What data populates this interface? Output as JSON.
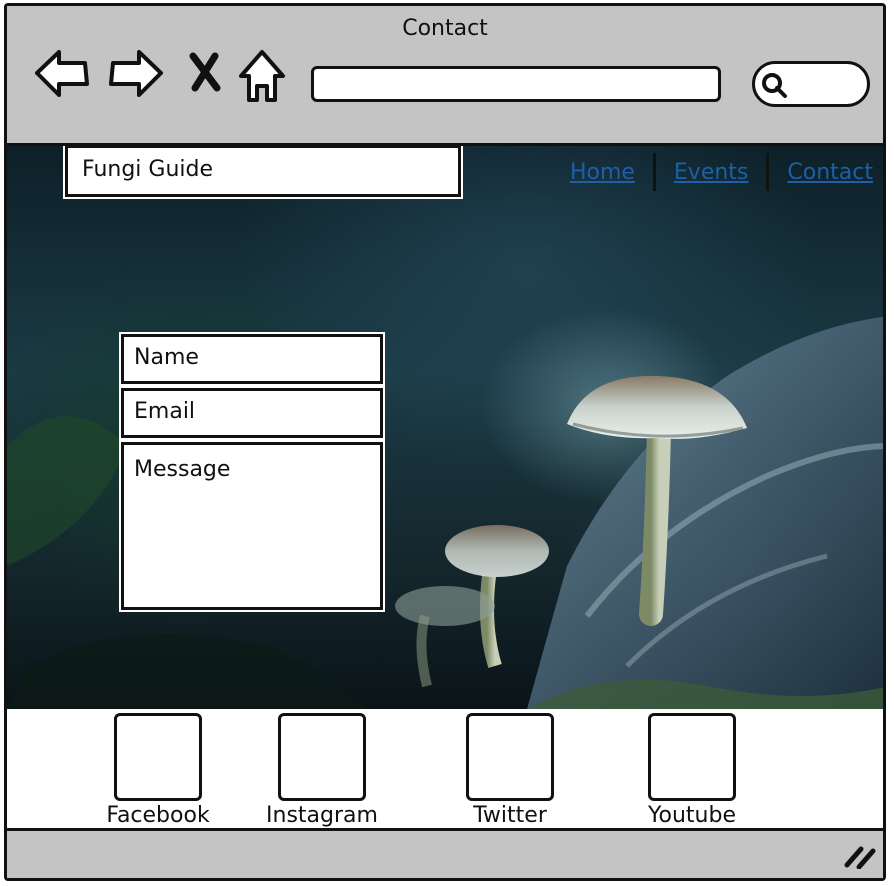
{
  "window": {
    "title": "Contact"
  },
  "toolbar": {
    "back_icon": "arrow-left-icon",
    "forward_icon": "arrow-right-icon",
    "stop_icon": "close-icon",
    "home_icon": "home-icon",
    "search_icon": "search-icon",
    "address_value": "",
    "search_value": ""
  },
  "site": {
    "brand": "Fungi Guide",
    "nav": [
      {
        "label": "Home"
      },
      {
        "label": "Events"
      },
      {
        "label": "Contact"
      }
    ]
  },
  "form": {
    "name_placeholder": "Name",
    "email_placeholder": "Email",
    "message_placeholder": "Message"
  },
  "social": [
    {
      "label": "Facebook"
    },
    {
      "label": "Instagram"
    },
    {
      "label": "Twitter"
    },
    {
      "label": "Youtube"
    }
  ],
  "statusbar": {
    "resize_icon": "resize-handle-icon"
  },
  "colors": {
    "chrome": "#c4c4c4",
    "link": "#1d5fa8",
    "border": "#111111"
  }
}
